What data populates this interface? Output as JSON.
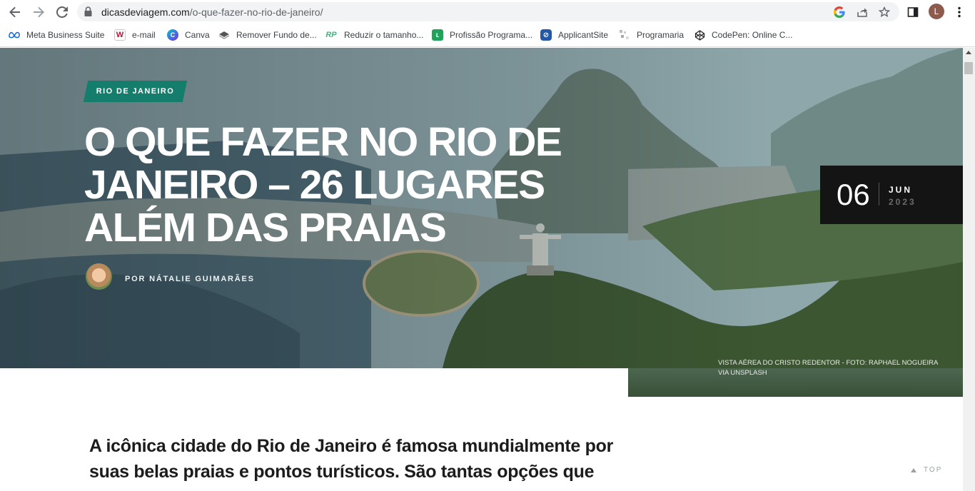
{
  "browser": {
    "url_domain": "dicasdeviagem.com",
    "url_path": "/o-que-fazer-no-rio-de-janeiro/",
    "profile_initial": "L",
    "icons": [
      "back-icon",
      "forward-icon",
      "reload-icon",
      "lock-icon",
      "google-icon",
      "share-icon",
      "star-icon",
      "sidepanel-icon",
      "menu-icon"
    ]
  },
  "bookmarks": [
    {
      "label": "Meta Business Suite",
      "icon": "meta-icon"
    },
    {
      "label": "e-mail",
      "icon": "email-icon"
    },
    {
      "label": "Canva",
      "icon": "canva-icon"
    },
    {
      "label": "Remover Fundo de...",
      "icon": "remove-bg-icon"
    },
    {
      "label": "Reduzir o tamanho...",
      "icon": "rp-icon"
    },
    {
      "label": "Profissão Programa...",
      "icon": "profissao-icon"
    },
    {
      "label": "ApplicantSite",
      "icon": "applicantsite-icon"
    },
    {
      "label": "Programaria",
      "icon": "programaria-icon"
    },
    {
      "label": "CodePen: Online C...",
      "icon": "codepen-icon"
    }
  ],
  "article": {
    "category": "RIO DE JANEIRO",
    "title": "O QUE FAZER NO RIO DE JANEIRO – 26 LUGARES ALÉM DAS PRAIAS",
    "author": "POR NÁTALIE GUIMARÃES",
    "date_day": "06",
    "date_month": "JUN",
    "date_year": "2023",
    "image_caption": "VISTA AÉREA DO CRISTO REDENTOR - FOTO: RAPHAEL NOGUEIRA VIA UNSPLASH",
    "lead": "A icônica cidade do Rio de Janeiro é famosa mundialmente por suas belas praias e pontos turísticos. São tantas opções que"
  },
  "back_to_top": "TOP",
  "colors": {
    "category_bg": "#157d6b",
    "date_box_bg": "#141414"
  }
}
